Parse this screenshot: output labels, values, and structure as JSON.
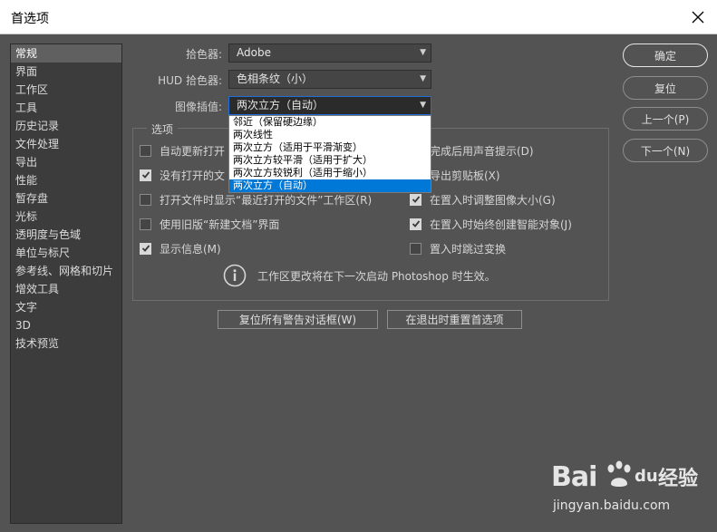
{
  "dialog": {
    "title": "首选项"
  },
  "sidebar": {
    "items": [
      "常规",
      "界面",
      "工作区",
      "工具",
      "历史记录",
      "文件处理",
      "导出",
      "性能",
      "暂存盘",
      "光标",
      "透明度与色域",
      "单位与标尺",
      "参考线、网格和切片",
      "增效工具",
      "文字",
      "3D",
      "技术预览"
    ],
    "active_index": 0
  },
  "fields": {
    "color_picker": {
      "label": "拾色器:",
      "value": "Adobe"
    },
    "hud_picker": {
      "label": "HUD 拾色器:",
      "value": "色相条纹（小）"
    },
    "interpolation": {
      "label": "图像插值:",
      "value": "两次立方（自动）"
    }
  },
  "dropdown": {
    "options": [
      "邻近（保留硬边缘）",
      "两次线性",
      "两次立方（适用于平滑渐变）",
      "两次立方较平滑（适用于扩大）",
      "两次立方较锐利（适用于缩小）",
      "两次立方（自动）"
    ],
    "selected_index": 5
  },
  "options": {
    "legend": "选项",
    "left": [
      {
        "label": "自动更新打开",
        "checked": false
      },
      {
        "label": "没有打开的文",
        "checked": true
      },
      {
        "label": "打开文件时显示“最近打开的文件”工作区(R)",
        "checked": false
      },
      {
        "label": "使用旧版“新建文档”界面",
        "checked": false
      },
      {
        "label": "显示信息(M)",
        "checked": true
      }
    ],
    "right": [
      {
        "label": "完成后用声音提示(D)",
        "checked": null
      },
      {
        "label": "导出剪贴板(X)",
        "checked": null
      },
      {
        "label": "在置入时调整图像大小(G)",
        "checked": true
      },
      {
        "label": "在置入时始终创建智能对象(J)",
        "checked": true
      },
      {
        "label": "置入时跳过变换",
        "checked": false
      }
    ],
    "info_text": "工作区更改将在下一次启动 Photoshop 时生效。"
  },
  "bottom_buttons": {
    "reset_warnings": "复位所有警告对话框(W)",
    "reset_on_quit": "在退出时重置首选项"
  },
  "right_buttons": {
    "ok": "确定",
    "reset": "复位",
    "prev": "上一个(P)",
    "next": "下一个(N)"
  },
  "watermark": {
    "brand": "Bai",
    "brand_suffix": "du",
    "site_cn": "经验",
    "url": "jingyan.baidu.com"
  },
  "colors": {
    "dialog_bg": "#535353",
    "sidebar_bg": "#3c3c3c",
    "selection": "#0078d7"
  }
}
